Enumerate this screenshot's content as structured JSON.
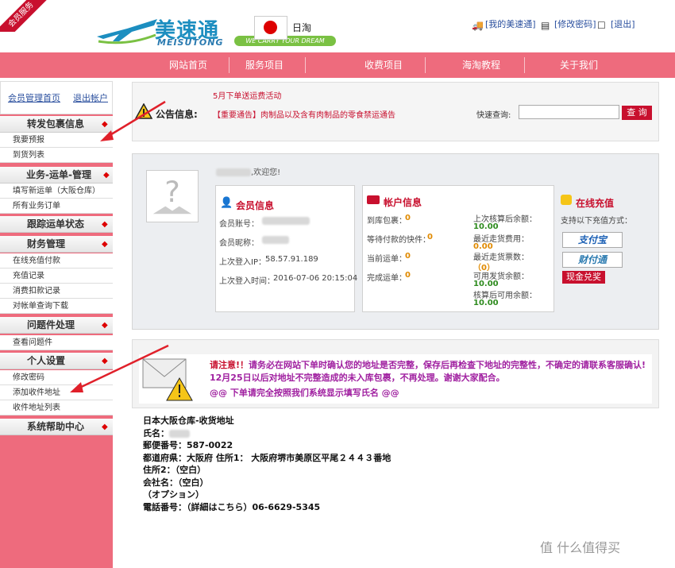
{
  "header": {
    "corner_ribbon": "会员服务",
    "logo_cn": "美速通",
    "logo_en": "MEISUTONG",
    "logo_slogan": "WE CARRY YOUR DREAM",
    "region_label": "日淘",
    "links": [
      {
        "label": "[我的美速通]",
        "icon": "truck-icon"
      },
      {
        "label": "[修改密码]",
        "icon": "document-icon"
      },
      {
        "label": "[退出]",
        "icon": "exit-icon"
      }
    ]
  },
  "nav": {
    "items": [
      "网站首页",
      "服务项目",
      "收费项目",
      "海淘教程",
      "关于我们"
    ]
  },
  "sidebar": {
    "top_links": [
      "会员管理首页",
      "退出帐户"
    ],
    "sections": [
      {
        "title": "转发包裹信息",
        "items": [
          "我要预报",
          "到货列表"
        ]
      },
      {
        "title": "业务-运单-管理",
        "items": [
          "填写新运单（大阪仓库）",
          "所有业务订单"
        ]
      },
      {
        "title": "跟踪运单状态",
        "items": []
      },
      {
        "title": "财务管理",
        "items": [
          "在线充值付款",
          "充值记录",
          "消费扣款记录",
          "对帐单查询下载"
        ]
      },
      {
        "title": "问题件处理",
        "items": [
          "查看问题件"
        ]
      },
      {
        "title": "个人设置",
        "items": [
          "修改密码",
          "添加收件地址",
          "收件地址列表"
        ]
      },
      {
        "title": "系统帮助中心",
        "items": []
      }
    ],
    "marker": "◆"
  },
  "notice": {
    "promo": "5月下单送运费活动",
    "label": "公告信息:",
    "text": "【重要通告】肉制品以及含有肉制品的零食禁运通告",
    "quick_search_label": "快速查询:",
    "quick_search_value": "",
    "search_button": "查 询"
  },
  "member": {
    "welcome_suffix": ",欢迎您!",
    "info": {
      "title": "会员信息",
      "account_label": "会员账号：",
      "nickname_label": "会员昵称：",
      "last_ip_label": "上次登入IP：",
      "last_ip": "58.57.91.189",
      "last_time_label": "上次登入时间：",
      "last_time": "2016-07-06 20:15:04"
    },
    "account": {
      "title": "帐户信息",
      "rows": [
        {
          "label": "到库包裹：",
          "value": "0"
        },
        {
          "label": "等待付款的快件：",
          "value": "0"
        },
        {
          "label": "当前运单：",
          "value": "0"
        },
        {
          "label": "完成运单：",
          "value": "0"
        }
      ],
      "balances": [
        {
          "label": "上次核算后余额：",
          "value": "10.00"
        },
        {
          "label": "最近走货费用：",
          "value": "0.00"
        },
        {
          "label": "最近走货票数：",
          "value": "（0）"
        },
        {
          "label": "可用发货余额：",
          "value": "10.00"
        },
        {
          "label": "核算后可用余额：",
          "value": "10.00"
        }
      ]
    },
    "recharge": {
      "title": "在线充值",
      "subtitle": "支持以下充值方式：",
      "alipay": "支付宝",
      "tenpay": "财付通",
      "cash_button": "现金兑奖"
    }
  },
  "alert": {
    "prefix": "请注意!！",
    "line1": "请务必在网站下单时确认您的地址是否完整，保存后再检查下地址的完整性，不确定的请联系客服确认! 12月25日以后对地址不完整造成的未入库包裹，不再处理。谢谢大家配合。",
    "line2": "@@ 下单请完全按照我们系统显示填写氏名 @@"
  },
  "address": {
    "title": "日本大阪仓库-收货地址",
    "name_label": "氏名：",
    "postal": "郵便番号：587-0022",
    "prefecture": "都道府県：大阪府 住所1： 大阪府堺市美原区平尾２４４３番地",
    "address2": "住所2：（空白）",
    "company": "会社名：（空白）",
    "option": "（オプション）",
    "phone": "電話番号：（詳細はこちら）06-6629-5345"
  },
  "watermark": "值 什么值得买",
  "colors": {
    "accent": "#ee6b7d",
    "red": "#c8102e",
    "green": "#2e8b1e",
    "link": "#2a4f9e"
  }
}
